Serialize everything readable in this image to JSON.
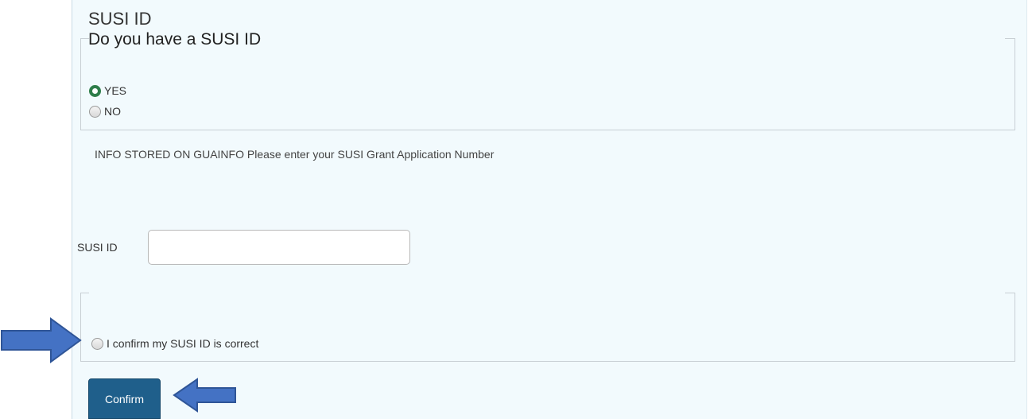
{
  "section": {
    "title": "SUSI ID",
    "question": "Do you have a SUSI ID",
    "options": [
      {
        "label": "YES",
        "selected": true
      },
      {
        "label": "NO",
        "selected": false
      }
    ]
  },
  "info": {
    "text": "INFO STORED ON GUAINFO Please enter your SUSI Grant Application Number"
  },
  "susi_field": {
    "label": "SUSI ID",
    "value": "",
    "placeholder": ""
  },
  "confirm_check": {
    "label": "I confirm my SUSI ID is correct",
    "selected": false
  },
  "button": {
    "label": "Confirm"
  },
  "colors": {
    "panel_bg": "#f2fafd",
    "button_bg": "#1f5f8b",
    "radio_selected": "#2e7d4a",
    "annotation_arrow": "#4472c4"
  },
  "annotations": [
    {
      "icon": "arrow-right-icon",
      "points_to": "confirm-checkbox-radio"
    },
    {
      "icon": "arrow-left-icon",
      "points_to": "confirm-button"
    }
  ]
}
